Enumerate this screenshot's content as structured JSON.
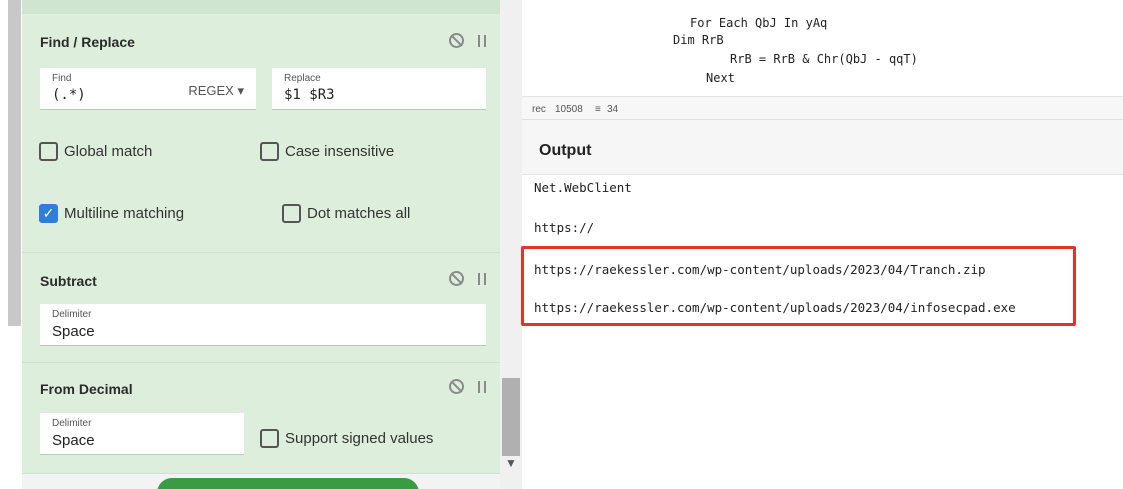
{
  "recipe": {
    "find_replace": {
      "title": "Find / Replace",
      "find_label": "Find",
      "find_value": "(.*)",
      "find_mode": "REGEX ▾",
      "replace_label": "Replace",
      "replace_value": "$1 $R3",
      "global_match": "Global match",
      "global_match_checked": false,
      "case_insensitive": "Case insensitive",
      "case_insensitive_checked": false,
      "multiline": "Multiline matching",
      "multiline_checked": true,
      "dot_matches_all": "Dot matches all",
      "dot_matches_all_checked": false
    },
    "subtract": {
      "title": "Subtract",
      "delimiter_label": "Delimiter",
      "delimiter_value": "Space"
    },
    "from_decimal": {
      "title": "From Decimal",
      "delimiter_label": "Delimiter",
      "delimiter_value": "Space",
      "signed_label": "Support signed values",
      "signed_checked": false
    }
  },
  "code": {
    "lines": [
      "For Each QbJ In yAq",
      "Dim RrB",
      "RrB = RrB & Chr(QbJ - qqT)",
      "Next"
    ]
  },
  "status": {
    "chars_icon": "rec",
    "chars": "10508",
    "lines_icon": "≡",
    "lines": "34"
  },
  "output": {
    "title": "Output",
    "lines": [
      "Net.WebClient",
      "https://",
      "https://raekessler.com/wp-content/uploads/2023/04/Tranch.zip",
      "https://raekessler.com/wp-content/uploads/2023/04/infosecpad.exe"
    ]
  },
  "colors": {
    "op_bg": "#ddeedd",
    "highlight": "#e0342f",
    "check_on": "#2f7fd8",
    "bake": "#3c9a45"
  }
}
